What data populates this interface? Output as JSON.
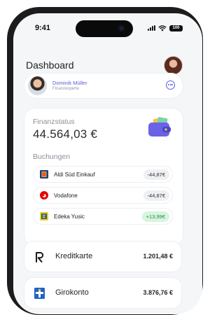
{
  "status_bar": {
    "time": "9:41",
    "battery": "100"
  },
  "header": {
    "title": "Dashboard",
    "avatar_icon": "user-avatar"
  },
  "advisor": {
    "name": "Dominik Müller",
    "role": "Finanzexperte",
    "action_icon": "chat-bubble-icon"
  },
  "finance": {
    "status_label": "Finanzstatus",
    "total": "44.564,03 €",
    "bookings_label": "Buchungen",
    "transactions": [
      {
        "name": "Aldi Süd Einkauf",
        "amount": "-44,87€",
        "logo": "aldi-logo",
        "positive": false
      },
      {
        "name": "Vodafone",
        "amount": "-44,87€",
        "logo": "vodafone-logo",
        "positive": false
      },
      {
        "name": "Edeka Yusic",
        "amount": "+13,99€",
        "logo": "edeka-logo",
        "positive": true
      }
    ]
  },
  "accounts": [
    {
      "name": "Kreditkarte",
      "amount": "1.201,48 €",
      "icon": "revolut-logo"
    },
    {
      "name": "Girokonto",
      "amount": "3.876,76 €",
      "icon": "sparkasse-logo"
    }
  ],
  "colors": {
    "accent": "#5b5ce0",
    "positive": "#2a8a45",
    "positive_bg": "#d8f5df",
    "background": "#f5f6f8"
  }
}
